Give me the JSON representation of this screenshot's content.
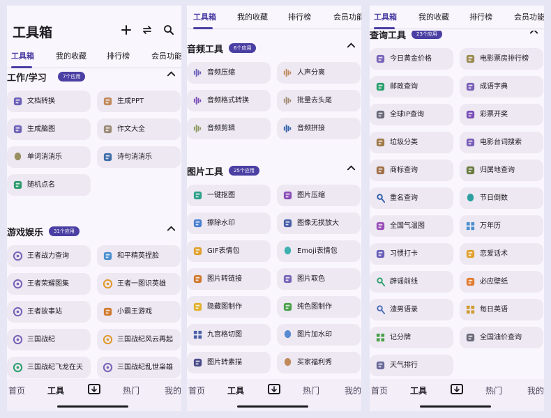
{
  "screens": [
    {
      "app_title": "工具箱",
      "tabs": [
        "工具箱",
        "我的收藏",
        "排行榜",
        "会员功能"
      ],
      "active_tab": 0,
      "sections": [
        {
          "title": "工作/学习",
          "badge": "7个应用",
          "items": [
            {
              "label": "文档转换",
              "icon": "document-convert-icon",
              "color": "#6c5fb8"
            },
            {
              "label": "生成PPT",
              "icon": "ppt-icon",
              "color": "#c08a5c"
            },
            {
              "label": "生成脑图",
              "icon": "mind-map-icon",
              "color": "#6f64b8"
            },
            {
              "label": "作文大全",
              "icon": "essay-icon",
              "color": "#9a8a76"
            },
            {
              "label": "单词消消乐",
              "icon": "lightbulb-icon",
              "color": "#9a8f60"
            },
            {
              "label": "诗句消消乐",
              "icon": "poetry-icon",
              "color": "#3f6da8"
            },
            {
              "label": "随机点名",
              "icon": "random-pick-icon",
              "color": "#2e9a6e"
            }
          ]
        },
        {
          "title": "游戏娱乐",
          "badge": "31个应用",
          "items": [
            {
              "label": "王者战力查询",
              "icon": "game-target-icon",
              "color": "#7a64b8"
            },
            {
              "label": "和平精英捏脸",
              "icon": "helmet-icon",
              "color": "#4a8fd0"
            },
            {
              "label": "王者荣耀图集",
              "icon": "game-target-icon",
              "color": "#7a64b8"
            },
            {
              "label": "王者一图识英雄",
              "icon": "game-target-icon",
              "color": "#e09a2e"
            },
            {
              "label": "王者故事站",
              "icon": "game-target-icon",
              "color": "#7a64b8"
            },
            {
              "label": "小霸王游戏",
              "icon": "controller-icon",
              "color": "#d07a2e"
            },
            {
              "label": "三国战纪",
              "icon": "sanguo-icon",
              "color": "#7a64b8"
            },
            {
              "label": "三国战纪风云再起",
              "icon": "sanguo-icon",
              "color": "#e09a2e"
            },
            {
              "label": "三国战纪飞龙在天",
              "icon": "sanguo-icon",
              "color": "#2ea06e"
            },
            {
              "label": "三国战纪乱世枭雄",
              "icon": "sanguo-icon",
              "color": "#7a64b8"
            }
          ]
        }
      ],
      "bottom_nav": [
        "首页",
        "工具",
        "",
        "热门",
        "我的"
      ],
      "active_nav": 1
    },
    {
      "tabs": [
        "工具箱",
        "我的收藏",
        "排行榜",
        "会员功能"
      ],
      "active_tab": 0,
      "sections": [
        {
          "title": "音频工具",
          "badge": "6个应用",
          "items": [
            {
              "label": "音频压缩",
              "icon": "audio-compress-icon",
              "color": "#6c5fb8"
            },
            {
              "label": "人声分离",
              "icon": "voice-split-icon",
              "color": "#c08a5c"
            },
            {
              "label": "音频格式转换",
              "icon": "audio-convert-icon",
              "color": "#7a4fb8"
            },
            {
              "label": "批量去头尾",
              "icon": "trim-icon",
              "color": "#a08a70"
            },
            {
              "label": "音频剪辑",
              "icon": "waveform-icon",
              "color": "#8a9a60"
            },
            {
              "label": "音频拼接",
              "icon": "audio-join-icon",
              "color": "#2e5fa8"
            }
          ]
        },
        {
          "title": "图片工具",
          "badge": "25个应用",
          "items": [
            {
              "label": "一键抠图",
              "icon": "magic-wand-icon",
              "color": "#2ea08a"
            },
            {
              "label": "图片压缩",
              "icon": "image-compress-icon",
              "color": "#8a4fb8"
            },
            {
              "label": "擦除水印",
              "icon": "erase-icon",
              "color": "#4a7fd0"
            },
            {
              "label": "图像无损放大",
              "icon": "image-enlarge-icon",
              "color": "#4a5fa8"
            },
            {
              "label": "GIF表情包",
              "icon": "gif-icon",
              "color": "#e0a02e"
            },
            {
              "label": "Emoji表情包",
              "icon": "ghost-icon",
              "color": "#3fb0b0"
            },
            {
              "label": "图片转链接",
              "icon": "link-nodes-icon",
              "color": "#d07a2e"
            },
            {
              "label": "图片取色",
              "icon": "color-picker-icon",
              "color": "#7a64b8"
            },
            {
              "label": "隐藏图制作",
              "icon": "hidden-image-icon",
              "color": "#e0b02e"
            },
            {
              "label": "纯色图制作",
              "icon": "paint-roller-icon",
              "color": "#4aa04a"
            },
            {
              "label": "九宫格切图",
              "icon": "grid-icon",
              "color": "#4a5fa8"
            },
            {
              "label": "图片加水印",
              "icon": "water-drop-icon",
              "color": "#5a8ad0"
            },
            {
              "label": "图片转素描",
              "icon": "sketch-icon",
              "color": "#4a4a8a"
            },
            {
              "label": "买家福利秀",
              "icon": "egg-icon",
              "color": "#c08a5c"
            }
          ]
        }
      ],
      "bottom_nav": [
        "首页",
        "工具",
        "",
        "热门",
        "我的"
      ],
      "active_nav": 1
    },
    {
      "tabs": [
        "工具箱",
        "我的收藏",
        "排行榜",
        "会员功能"
      ],
      "active_tab": 0,
      "sections": [
        {
          "title": "查询工具",
          "badge": "23个应用",
          "items": [
            {
              "label": "今日黄金价格",
              "icon": "gold-icon",
              "color": "#7a64b8"
            },
            {
              "label": "电影票房排行榜",
              "icon": "ufo-icon",
              "color": "#9a8a50"
            },
            {
              "label": "邮政查询",
              "icon": "post-icon",
              "color": "#2ea06e"
            },
            {
              "label": "成语字典",
              "icon": "dictionary-icon",
              "color": "#7a5fb8"
            },
            {
              "label": "全球IP查询",
              "icon": "database-icon",
              "color": "#6a6a7a"
            },
            {
              "label": "彩票开奖",
              "icon": "lottery-icon",
              "color": "#7a4fb8"
            },
            {
              "label": "垃圾分类",
              "icon": "trash-icon",
              "color": "#a07a4a"
            },
            {
              "label": "电影台词搜索",
              "icon": "film-reel-icon",
              "color": "#7a5fb8"
            },
            {
              "label": "商标查询",
              "icon": "trademark-icon",
              "color": "#a0704a"
            },
            {
              "label": "归属地查询",
              "icon": "location-icon",
              "color": "#6a7a40"
            },
            {
              "label": "重名查询",
              "icon": "people-icon",
              "color": "#2e5fa8"
            },
            {
              "label": "节日倒数",
              "icon": "balloon-icon",
              "color": "#2ea0a0"
            },
            {
              "label": "全国气温图",
              "icon": "thermometer-icon",
              "color": "#9a4fb8"
            },
            {
              "label": "万年历",
              "icon": "calendar-icon",
              "color": "#4a8fd0"
            },
            {
              "label": "习惯打卡",
              "icon": "habit-icon",
              "color": "#6a5fb8"
            },
            {
              "label": "恋爱话术",
              "icon": "love-icon",
              "color": "#e0a02e"
            },
            {
              "label": "辟谣前线",
              "icon": "search-zoom-icon",
              "color": "#2ea06e"
            },
            {
              "label": "必应壁纸",
              "icon": "bing-icon",
              "color": "#e07a2e"
            },
            {
              "label": "渣男语录",
              "icon": "male-icon",
              "color": "#4a6fb8"
            },
            {
              "label": "每日英语",
              "icon": "abc-blocks-icon",
              "color": "#d09a2e"
            },
            {
              "label": "记分牌",
              "icon": "scoreboard-icon",
              "color": "#4aa04a"
            },
            {
              "label": "全国油价查询",
              "icon": "oil-icon",
              "color": "#6a6a7a"
            },
            {
              "label": "天气排行",
              "icon": "weather-icon",
              "color": "#6a6a9a"
            }
          ]
        }
      ],
      "bottom_nav": [
        "首页",
        "工具",
        "",
        "热门",
        "我的"
      ],
      "active_nav": 1
    }
  ]
}
